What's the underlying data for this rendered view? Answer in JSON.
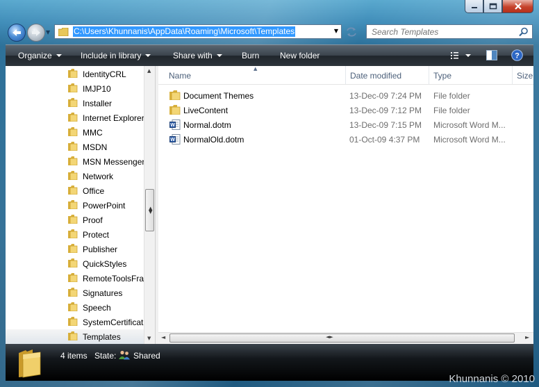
{
  "address": {
    "path": "C:\\Users\\Khunnanis\\AppData\\Roaming\\Microsoft\\Templates"
  },
  "search": {
    "placeholder": "Search Templates"
  },
  "toolbar": {
    "organize": "Organize",
    "include_in_library": "Include in library",
    "share_with": "Share with",
    "burn": "Burn",
    "new_folder": "New folder"
  },
  "nav_items": [
    {
      "label": "IdentityCRL"
    },
    {
      "label": "IMJP10"
    },
    {
      "label": "Installer"
    },
    {
      "label": "Internet Explorer"
    },
    {
      "label": "MMC"
    },
    {
      "label": "MSDN"
    },
    {
      "label": "MSN Messenger"
    },
    {
      "label": "Network"
    },
    {
      "label": "Office"
    },
    {
      "label": "PowerPoint"
    },
    {
      "label": "Proof"
    },
    {
      "label": "Protect"
    },
    {
      "label": "Publisher"
    },
    {
      "label": "QuickStyles"
    },
    {
      "label": "RemoteToolsFra"
    },
    {
      "label": "Signatures"
    },
    {
      "label": "Speech"
    },
    {
      "label": "SystemCertificat"
    },
    {
      "label": "Templates"
    }
  ],
  "columns": {
    "name": "Name",
    "date_modified": "Date modified",
    "type": "Type",
    "size": "Size"
  },
  "files": [
    {
      "name": "Document Themes",
      "date": "13-Dec-09 7:24 PM",
      "type": "File folder",
      "icon": "folder-icon"
    },
    {
      "name": "LiveContent",
      "date": "13-Dec-09 7:12 PM",
      "type": "File folder",
      "icon": "folder-icon"
    },
    {
      "name": "Normal.dotm",
      "date": "13-Dec-09 7:15 PM",
      "type": "Microsoft Word M...",
      "icon": "word-document-icon"
    },
    {
      "name": "NormalOld.dotm",
      "date": "01-Oct-09 4:37 PM",
      "type": "Microsoft Word M...",
      "icon": "word-document-icon"
    }
  ],
  "status": {
    "item_count": "4 items",
    "state_label": "State:",
    "state_value": "Shared"
  },
  "watermark": "Khunnanis © 2010"
}
